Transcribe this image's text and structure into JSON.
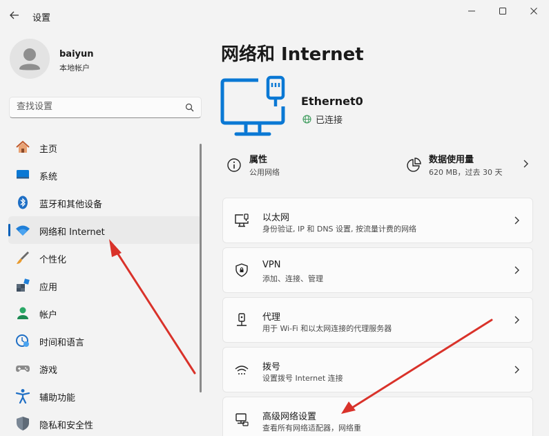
{
  "window": {
    "title": "设置",
    "controls": {
      "minimize": "minimize-icon",
      "maximize": "maximize-icon",
      "close": "close-icon"
    }
  },
  "profile": {
    "name": "baiyun",
    "account_type": "本地帐户"
  },
  "search": {
    "placeholder": "查找设置"
  },
  "sidebar": {
    "items": [
      {
        "label": "主页",
        "icon": "home-icon"
      },
      {
        "label": "系统",
        "icon": "system-icon"
      },
      {
        "label": "蓝牙和其他设备",
        "icon": "bluetooth-icon"
      },
      {
        "label": "网络和 Internet",
        "icon": "wifi-icon",
        "active": true
      },
      {
        "label": "个性化",
        "icon": "brush-icon"
      },
      {
        "label": "应用",
        "icon": "apps-icon"
      },
      {
        "label": "帐户",
        "icon": "account-icon"
      },
      {
        "label": "时间和语言",
        "icon": "time-language-icon"
      },
      {
        "label": "游戏",
        "icon": "gamepad-icon"
      },
      {
        "label": "辅助功能",
        "icon": "accessibility-icon"
      },
      {
        "label": "隐私和安全性",
        "icon": "shield-icon"
      }
    ]
  },
  "main": {
    "title": "网络和 Internet",
    "device": {
      "name": "Ethernet0",
      "status": "已连接"
    },
    "properties": {
      "title": "属性",
      "subtitle": "公用网络"
    },
    "data_usage": {
      "title": "数据使用量",
      "subtitle": "620 MB，过去 30 天"
    },
    "cards": [
      {
        "title": "以太网",
        "subtitle": "身份验证, IP 和 DNS 设置, 按流量计费的网络",
        "icon": "ethernet-icon"
      },
      {
        "title": "VPN",
        "subtitle": "添加、连接、管理",
        "icon": "vpn-shield-icon"
      },
      {
        "title": "代理",
        "subtitle": "用于 Wi-Fi 和以太网连接的代理服务器",
        "icon": "proxy-icon"
      },
      {
        "title": "拨号",
        "subtitle": "设置拨号 Internet 连接",
        "icon": "dialup-icon"
      },
      {
        "title": "高级网络设置",
        "subtitle": "查看所有网络适配器，网络重",
        "icon": "advanced-network-icon"
      }
    ]
  },
  "colors": {
    "accent": "#005fb8",
    "annotation_arrow": "#d9322a",
    "hero_icon": "#0a78d4"
  }
}
